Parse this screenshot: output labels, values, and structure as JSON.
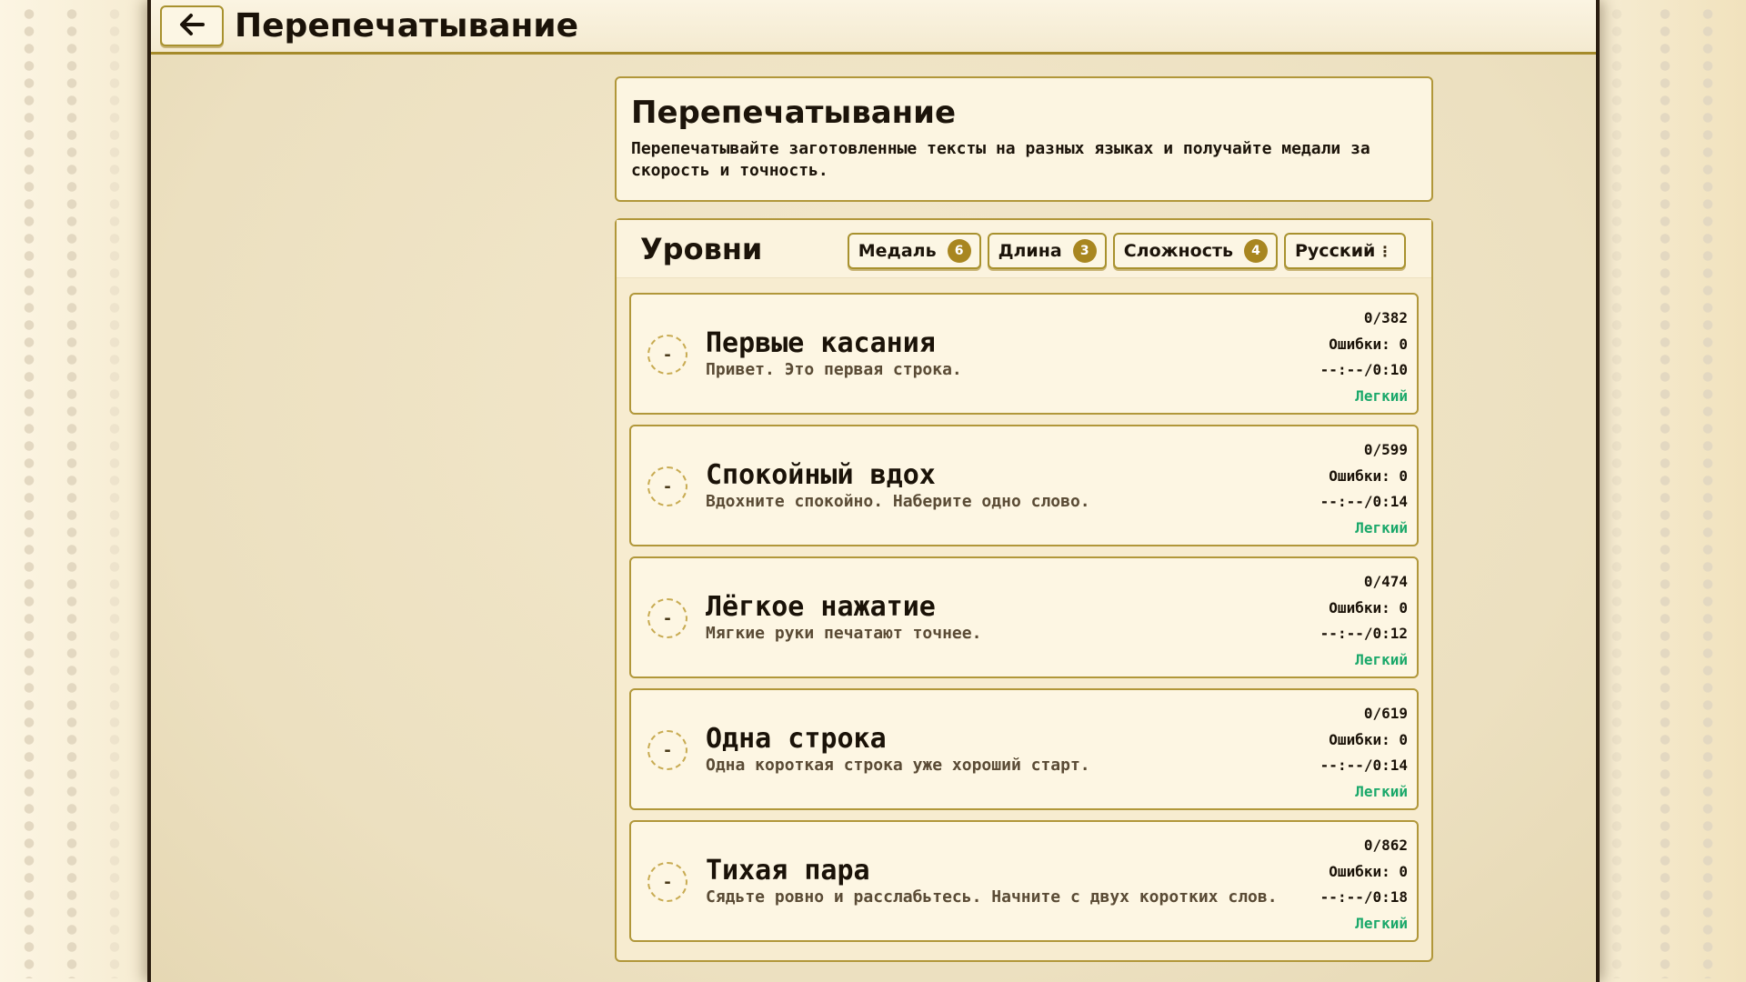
{
  "topbar": {
    "title": "Перепечатывание"
  },
  "header": {
    "title": "Перепечатывание",
    "description": "Перепечатывайте заготовленные тексты на разных языках и получайте медали за скорость и точность."
  },
  "levels": {
    "title": "Уровни",
    "filters": [
      {
        "label": "Медаль",
        "count": "6"
      },
      {
        "label": "Длина",
        "count": "3"
      },
      {
        "label": "Сложность",
        "count": "4"
      }
    ],
    "language": {
      "label": "Русский",
      "menu_icon": "kebab-icon"
    },
    "items": [
      {
        "medal": "-",
        "title": "Первые касания",
        "description": "Привет. Это первая строка.",
        "progress": "0/382",
        "errors": "Ошибки: 0",
        "time": "--:--/0:10",
        "difficulty": "Легкий"
      },
      {
        "medal": "-",
        "title": "Спокойный вдох",
        "description": "Вдохните спокойно. Наберите одно слово.",
        "progress": "0/599",
        "errors": "Ошибки: 0",
        "time": "--:--/0:14",
        "difficulty": "Легкий"
      },
      {
        "medal": "-",
        "title": "Лёгкое нажатие",
        "description": "Мягкие руки печатают точнее.",
        "progress": "0/474",
        "errors": "Ошибки: 0",
        "time": "--:--/0:12",
        "difficulty": "Легкий"
      },
      {
        "medal": "-",
        "title": "Одна строка",
        "description": "Одна короткая строка уже хороший старт.",
        "progress": "0/619",
        "errors": "Ошибки: 0",
        "time": "--:--/0:14",
        "difficulty": "Легкий"
      },
      {
        "medal": "-",
        "title": "Тихая пара",
        "description": "Сядьте ровно и расслабьтесь. Начните с двух коротких слов.",
        "progress": "0/862",
        "errors": "Ошибки: 0",
        "time": "--:--/0:18",
        "difficulty": "Легкий"
      }
    ]
  },
  "colors": {
    "background": "#f8efd8",
    "border_accent": "#b1973a",
    "badge": "#a88620",
    "difficulty_easy": "#1aa86a"
  }
}
